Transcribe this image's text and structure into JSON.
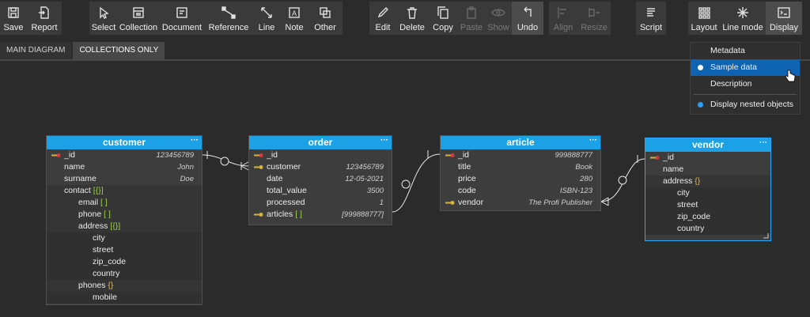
{
  "toolbar": {
    "group1": [
      {
        "label": "Save",
        "icon": "save-icon"
      },
      {
        "label": "Report",
        "icon": "report-icon"
      }
    ],
    "group2": [
      {
        "label": "Select",
        "icon": "cursor-icon"
      },
      {
        "label": "Collection",
        "icon": "collection-icon"
      },
      {
        "label": "Document",
        "icon": "document-icon"
      },
      {
        "label": "Reference",
        "icon": "reference-icon"
      },
      {
        "label": "Line",
        "icon": "line-icon"
      },
      {
        "label": "Note",
        "icon": "note-icon"
      },
      {
        "label": "Other",
        "icon": "other-icon"
      }
    ],
    "group3": [
      {
        "label": "Edit",
        "icon": "pencil-icon"
      },
      {
        "label": "Delete",
        "icon": "trash-icon"
      },
      {
        "label": "Copy",
        "icon": "copy-icon"
      },
      {
        "label": "Paste",
        "icon": "paste-icon"
      },
      {
        "label": "Show",
        "icon": "eye-icon"
      },
      {
        "label": "Undo",
        "icon": "undo-icon"
      }
    ],
    "group4": [
      {
        "label": "Align",
        "icon": "align-icon"
      },
      {
        "label": "Resize",
        "icon": "resize-icon"
      }
    ],
    "group5": [
      {
        "label": "Script",
        "icon": "script-icon"
      }
    ],
    "group6": [
      {
        "label": "Layout",
        "icon": "layout-icon"
      },
      {
        "label": "Line mode",
        "icon": "line-mode-icon"
      },
      {
        "label": "Display",
        "icon": "display-icon"
      }
    ]
  },
  "tabs": [
    {
      "label": "MAIN DIAGRAM"
    },
    {
      "label": "COLLECTIONS ONLY"
    }
  ],
  "dropdown": {
    "items": [
      {
        "label": "Metadata"
      },
      {
        "label": "Sample data"
      },
      {
        "label": "Description"
      },
      {
        "label": "Display nested objects"
      }
    ]
  },
  "entities": {
    "customer": {
      "title": "customer",
      "menu": "···",
      "rows": [
        {
          "key": "_id",
          "value": "123456789"
        },
        {
          "key": "name",
          "value": "John"
        },
        {
          "key": "surname",
          "value": "Doe"
        },
        {
          "key": "contact",
          "bracket": "[{}]"
        },
        {
          "key": "email",
          "bracket": "[ ]"
        },
        {
          "key": "phone",
          "bracket": "[ ]"
        },
        {
          "key": "address",
          "bracket": "[{}]"
        },
        {
          "key": "city"
        },
        {
          "key": "street"
        },
        {
          "key": "zip_code"
        },
        {
          "key": "country"
        },
        {
          "key": "phones",
          "bracket": "{}"
        },
        {
          "key": "mobile"
        }
      ]
    },
    "order": {
      "title": "order",
      "menu": "···",
      "rows": [
        {
          "key": "_id",
          "value": ""
        },
        {
          "key": "customer",
          "value": "123456789"
        },
        {
          "key": "date",
          "value": "12-05-2021"
        },
        {
          "key": "total_value",
          "value": "3500"
        },
        {
          "key": "processed",
          "value": "1"
        },
        {
          "key": "articles",
          "bracket": "[ ]",
          "value": "[999888777]"
        }
      ]
    },
    "article": {
      "title": "article",
      "menu": "···",
      "rows": [
        {
          "key": "_id",
          "value": "999888777"
        },
        {
          "key": "title",
          "value": "Book"
        },
        {
          "key": "price",
          "value": "280"
        },
        {
          "key": "code",
          "value": "ISBN-123"
        },
        {
          "key": "vendor",
          "value": "The Profi Publisher"
        }
      ]
    },
    "vendor": {
      "title": "vendor",
      "menu": "···",
      "rows": [
        {
          "key": "_id"
        },
        {
          "key": "name"
        },
        {
          "key": "address",
          "bracket": "{}"
        },
        {
          "key": "city"
        },
        {
          "key": "street"
        },
        {
          "key": "zip_code"
        },
        {
          "key": "country"
        }
      ]
    }
  },
  "colors": {
    "accent": "#1ba1e6",
    "highlight": "#0f63b3",
    "bullet": "#2a9df4",
    "pk_key": "#d63a3a",
    "fk_key": "#d8b23a"
  }
}
